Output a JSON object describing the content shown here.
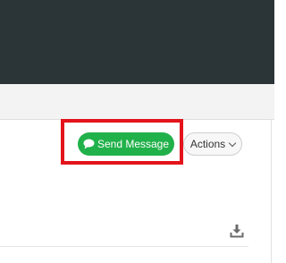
{
  "toolbar": {
    "send_message_label": "Send Message",
    "actions_label": "Actions"
  },
  "icons": {
    "send_message": "chat-bubble-icon",
    "actions_caret": "chevron-down-icon",
    "download": "download-icon"
  },
  "colors": {
    "header_bg": "#2b3436",
    "subheader_bg": "#f3f3f3",
    "send_button_bg": "#21b14a",
    "highlight": "#e3141b"
  }
}
